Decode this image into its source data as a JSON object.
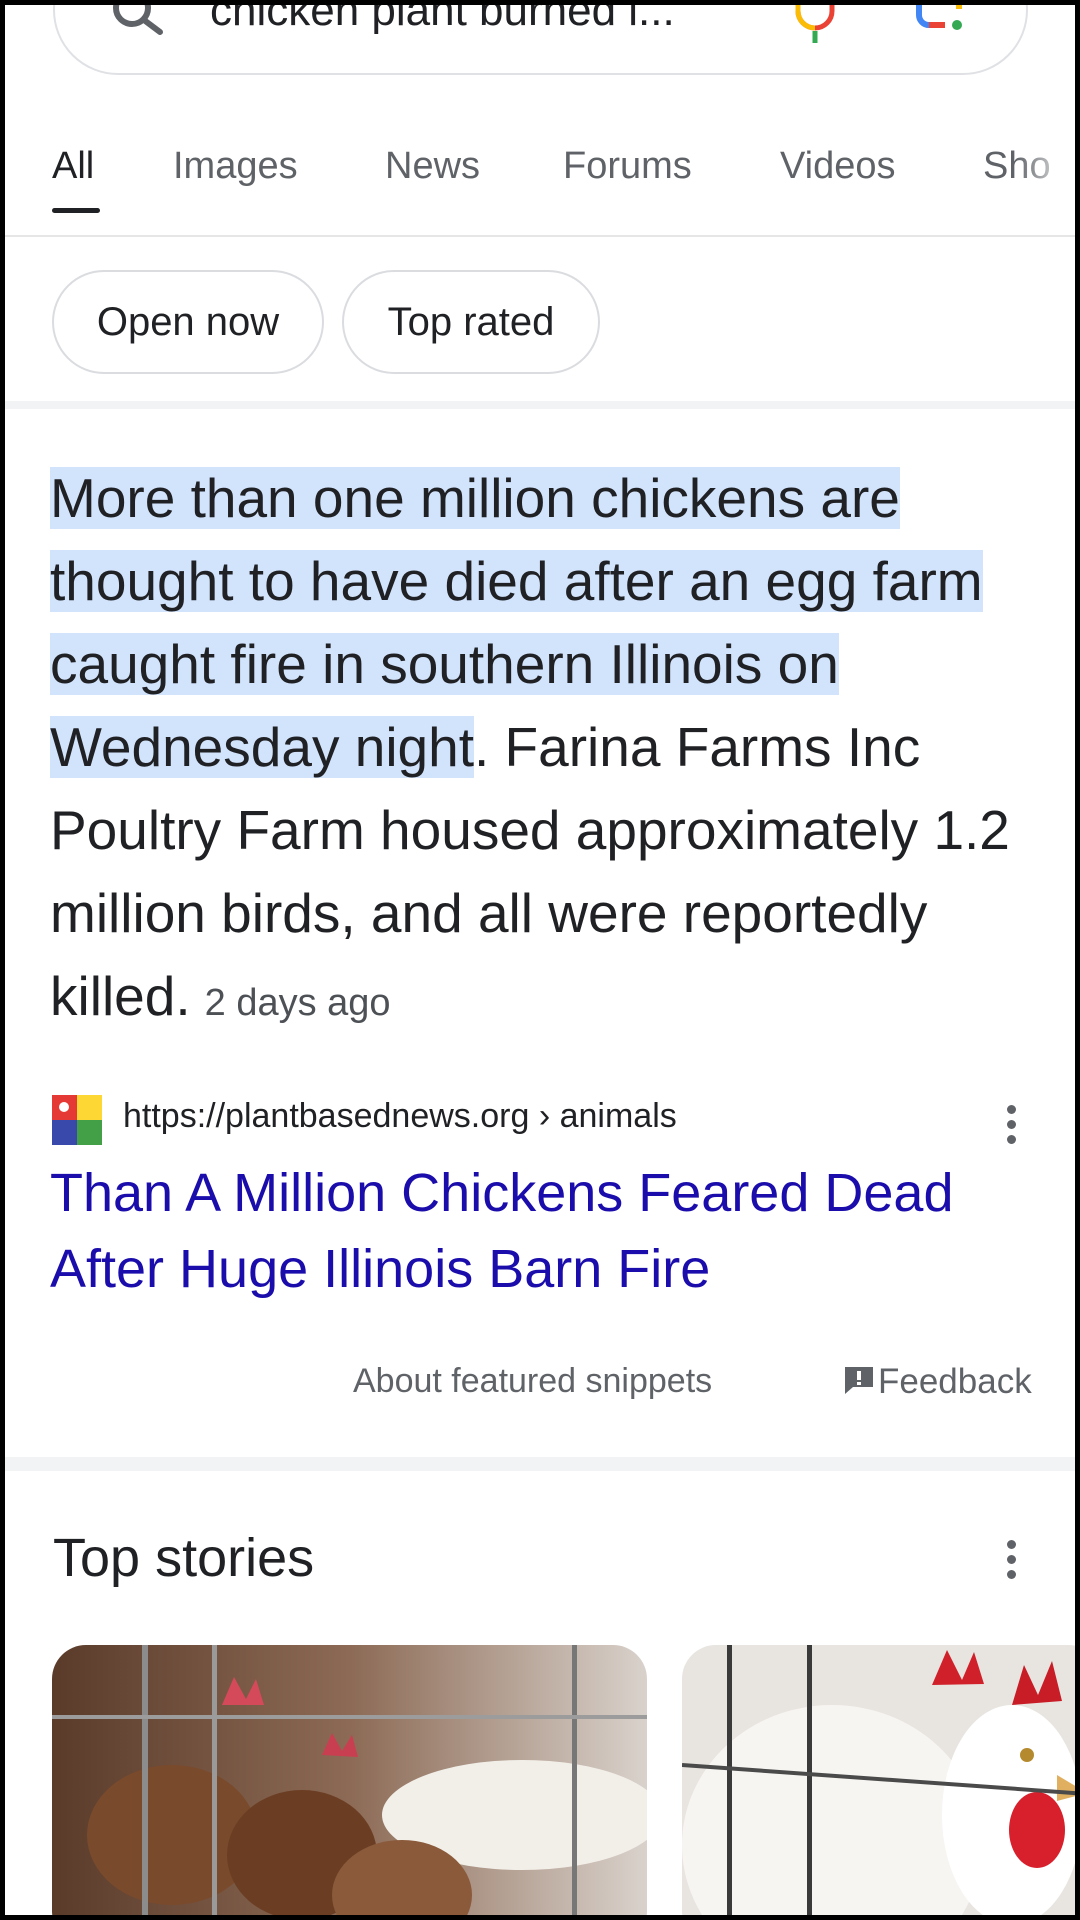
{
  "search": {
    "query": "chicken plant burned i..."
  },
  "tabs": [
    {
      "label": "All",
      "active": true
    },
    {
      "label": "Images"
    },
    {
      "label": "News"
    },
    {
      "label": "Forums"
    },
    {
      "label": "Videos"
    },
    {
      "label": "Sho"
    }
  ],
  "chips": [
    {
      "label": "Open now"
    },
    {
      "label": "Top rated"
    }
  ],
  "snippet": {
    "highlighted": "More than one million chickens are thought to have died after an egg farm caught fire in southern Illinois on Wednesday night",
    "rest": ". Farina Farms Inc Poultry Farm housed approximately 1.2 million birds, and all were reportedly killed.",
    "age": "2 days ago"
  },
  "source": {
    "url": "https://plantbasednews.org › animals",
    "title": "Than A Million Chickens Feared Dead After Huge Illinois Barn Fire"
  },
  "footer": {
    "about": "About featured snippets",
    "feedback": "Feedback"
  },
  "top_stories": {
    "heading": "Top stories"
  },
  "colors": {
    "link": "#1a0dab",
    "highlight": "#d2e3fc",
    "text": "#202124",
    "secondary": "#5f6368"
  }
}
